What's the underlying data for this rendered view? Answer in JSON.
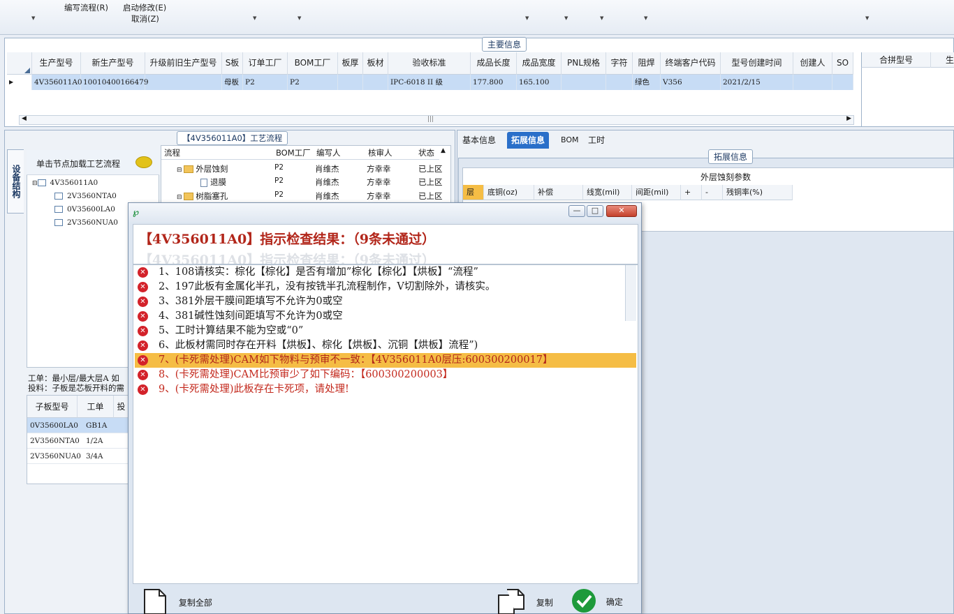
{
  "toolbar": {
    "items": [
      "编写流程(R)",
      "启动修改(E)",
      "取消(Z)"
    ]
  },
  "main_info": {
    "section_title": "主要信息",
    "columns": [
      "生产型号",
      "新生产型号",
      "升级前旧生产型号",
      "S板",
      "订单工厂",
      "BOM工厂",
      "板厚",
      "板材",
      "验收标准",
      "成品长度",
      "成品宽度",
      "PNL规格",
      "字符",
      "阻焊",
      "终端客户代码",
      "型号创建时间",
      "创建人",
      "SO"
    ],
    "row": [
      "4V356011A0",
      "10010400166479",
      "",
      "母板",
      "P2",
      "P2",
      "",
      "",
      "IPC-6018 II 级",
      "177.800",
      "165.100",
      "",
      "",
      "绿色",
      "V356",
      "2021/2/15",
      "",
      ""
    ],
    "merge_header": [
      "合拼型号",
      "生"
    ]
  },
  "left": {
    "vertical_tab": "设备结构",
    "tree_header": "单击节点加载工艺流程",
    "tree_root": "4V356011A0",
    "tree_children": [
      "2V3560NTA0",
      "0V35600LA0",
      "2V3560NUA0"
    ],
    "flow_title": "【4V356011A0】工艺流程",
    "flow_columns": [
      "流程",
      "BOM工厂",
      "编写人",
      "核审人",
      "状态"
    ],
    "flow_rows": [
      {
        "name": "外层蚀刻",
        "factory": "P2",
        "writer": "肖维杰",
        "checker": "方幸幸",
        "status": "已上区"
      },
      {
        "name": "退膜",
        "factory": "P2",
        "writer": "肖维杰",
        "checker": "方幸幸",
        "status": "已上区"
      },
      {
        "name": "树脂塞孔",
        "factory": "P2",
        "writer": "肖维杰",
        "checker": "方幸幸",
        "status": "已上区"
      }
    ],
    "work_order_text": [
      "工单：最小层/最大层A 如",
      "投料：子板是芯板开料的需"
    ],
    "sub_columns": [
      "子板型号",
      "工单",
      "投"
    ],
    "sub_rows": [
      {
        "model": "0V35600LA0",
        "order": "GB1A"
      },
      {
        "model": "2V3560NTA0",
        "order": "1/2A"
      },
      {
        "model": "2V3560NUA0",
        "order": "3/4A"
      }
    ]
  },
  "right": {
    "tabs": [
      "基本信息",
      "拓展信息",
      "BOM",
      "工时"
    ],
    "active_tab": "拓展信息",
    "section_title": "拓展信息",
    "etch_title": "外层蚀刻参数",
    "etch_columns": [
      "层",
      "底铜(oz)",
      "补偿",
      "线宽(mil)",
      "间距(mil)",
      "+",
      "-",
      "残铜率(%)"
    ]
  },
  "dialog": {
    "title": "【4V356011A0】指示检查结果：（9条未通过）",
    "messages": [
      "1、108请核实：棕化【棕化】是否有增加”棕化【棕化】【烘板】“流程”",
      "2、197此板有金属化半孔，没有按铣半孔流程制作，V切割除外，请核实。",
      "3、381外层干膜间距填写不允许为0或空",
      "4、381碱性蚀刻间距填写不允许为0或空",
      "5、工时计算结果不能为空或“0”",
      "6、此板材需同时存在开料【烘板】、棕化【烘板】、沉铜【烘板】流程”)",
      "7、(卡死需处理)CAM如下物料与预审不一致：【4V356011A0层压:600300200017】",
      "8、(卡死需处理)CAM比预审少了如下编码：【600300200003】",
      "9、(卡死需处理)此板存在卡死项，请处理!"
    ],
    "highlight_index": 6,
    "copy_all_label": "复制全部",
    "copy_label": "复制",
    "ok_label": "确定",
    "colors": {
      "error": "#d3222a",
      "highlight": "#f5bd45",
      "title": "#b2261a"
    }
  }
}
